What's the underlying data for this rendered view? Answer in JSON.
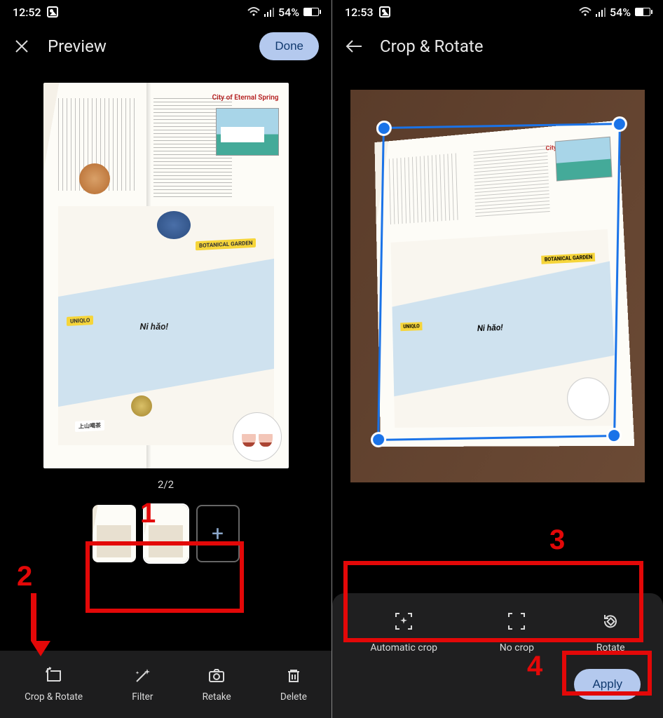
{
  "left": {
    "status": {
      "time": "12:52",
      "battery": "54%"
    },
    "header": {
      "title": "Preview",
      "done": "Done"
    },
    "book": {
      "city_header": "City of Eternal Spring",
      "ni_hao": "Ni hǎo!",
      "tag_garden": "BOTANICAL GARDEN",
      "tag_uniqlo": "UNIQLO",
      "tag_shop": "上山喝茶"
    },
    "page_counter": "2/2",
    "thumbs": {
      "add": "+"
    },
    "actions": {
      "crop_rotate": "Crop & Rotate",
      "filter": "Filter",
      "retake": "Retake",
      "delete": "Delete"
    },
    "annot": {
      "n1": "1",
      "n2": "2"
    }
  },
  "right": {
    "status": {
      "time": "12:53",
      "battery": "54%"
    },
    "header": {
      "title": "Crop & Rotate"
    },
    "actions": {
      "auto_crop": "Automatic crop",
      "no_crop": "No crop",
      "rotate": "Rotate"
    },
    "apply": "Apply",
    "annot": {
      "n3": "3",
      "n4": "4"
    }
  }
}
